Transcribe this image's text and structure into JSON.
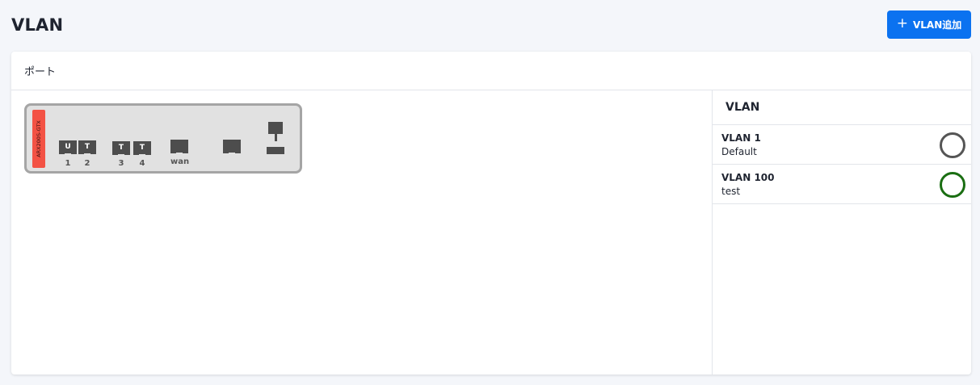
{
  "page": {
    "title": "VLAN"
  },
  "toolbar": {
    "add_icon": "plus-icon",
    "add_label": "VLAN追加",
    "accent": "#0b72f0"
  },
  "card": {
    "title": "ポート"
  },
  "device": {
    "model": "ARX200S-GTX",
    "ports": [
      {
        "id": "1",
        "label": "1",
        "tag": "U"
      },
      {
        "id": "2",
        "label": "2",
        "tag": "T"
      },
      {
        "id": "3",
        "label": "3",
        "tag": "T"
      },
      {
        "id": "4",
        "label": "4",
        "tag": "T"
      },
      {
        "id": "wan",
        "label": "wan",
        "tag": ""
      },
      {
        "id": "extra",
        "label": "",
        "tag": ""
      }
    ]
  },
  "vlan_panel": {
    "title": "VLAN",
    "items": [
      {
        "name": "VLAN 1",
        "description": "Default",
        "color": "#555555"
      },
      {
        "name": "VLAN 100",
        "description": "test",
        "color": "#1a6e12"
      }
    ]
  }
}
